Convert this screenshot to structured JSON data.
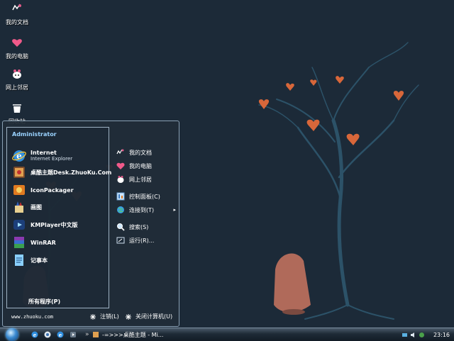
{
  "desktop": {
    "icons": [
      {
        "label": "我的文档",
        "icon": "documents-icon"
      },
      {
        "label": "我的电脑",
        "icon": "heart-computer-icon"
      },
      {
        "label": "网上邻居",
        "icon": "network-icon"
      },
      {
        "label": "回收站",
        "icon": "recycle-bin-icon"
      }
    ]
  },
  "start_menu": {
    "user": "Administrator",
    "programs": [
      {
        "label": "Internet",
        "sub": "Internet Explorer",
        "icon": "internet-explorer-icon"
      },
      {
        "label": "桌酷主题Desk.ZhuoKu.Com",
        "icon": "zhuoku-theme-icon"
      },
      {
        "label": "IconPackager",
        "icon": "iconpackager-icon"
      },
      {
        "label": "画图",
        "icon": "paint-icon"
      },
      {
        "label": "KMPlayer中文版",
        "icon": "kmplayer-icon"
      },
      {
        "label": "WinRAR",
        "icon": "winrar-icon"
      },
      {
        "label": "记事本",
        "icon": "notepad-icon"
      }
    ],
    "all_programs": "所有程序(P)",
    "places": [
      {
        "label": "我的文档",
        "icon": "documents-icon"
      },
      {
        "label": "我的电脑",
        "icon": "heart-computer-icon"
      },
      {
        "label": "网上邻居",
        "icon": "network-icon"
      },
      {
        "label": "控制面板(C)",
        "icon": "control-panel-icon"
      },
      {
        "label": "连接到(T)",
        "icon": "connect-globe-icon",
        "arrow": "▸"
      },
      {
        "label": "搜索(S)",
        "icon": "search-icon"
      },
      {
        "label": "运行(R)...",
        "icon": "run-icon"
      }
    ],
    "footer": {
      "site": "www.zhuoku.com",
      "logoff": "注销(L)",
      "shutdown": "关闭计算机(U)"
    }
  },
  "taskbar": {
    "separator": "»",
    "task_label": "-=>>>桌酷主题 - Mi...",
    "clock": "23:16"
  },
  "colors": {
    "background": "#1c2a38",
    "tree": "#2c5268",
    "leaf": "#d8673a",
    "accent": "#9ad2ff"
  }
}
